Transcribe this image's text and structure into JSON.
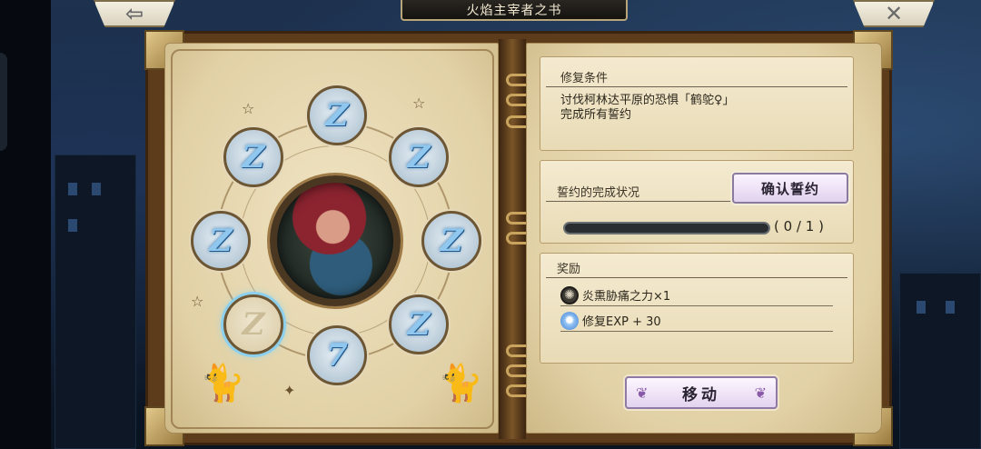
{
  "header": {
    "title": "火焰主宰者之书",
    "back_icon": "left-arrow-icon",
    "close_icon": "close-icon"
  },
  "book": {
    "slots": [
      {
        "id": "top",
        "glyph": "Z",
        "filled": true
      },
      {
        "id": "upper-right",
        "glyph": "Z",
        "filled": true
      },
      {
        "id": "right",
        "glyph": "Z",
        "filled": true
      },
      {
        "id": "lower-right",
        "glyph": "Z",
        "filled": true
      },
      {
        "id": "bottom",
        "glyph": "7",
        "filled": true
      },
      {
        "id": "lower-left",
        "glyph": "Z",
        "filled": false
      },
      {
        "id": "left",
        "glyph": "Z",
        "filled": true
      },
      {
        "id": "upper-left",
        "glyph": "Z",
        "filled": true
      }
    ]
  },
  "repair": {
    "heading": "修复条件",
    "line1": "讨伐柯林达平原的恐惧「鹤鸵♀」",
    "line2": "完成所有誓约"
  },
  "oath": {
    "heading": "誓约的完成状况",
    "confirm_label": "确认誓约",
    "progress": {
      "current": 0,
      "total": 1,
      "text": "( 0 / 1 )"
    }
  },
  "rewards": {
    "heading": "奖励",
    "items": [
      {
        "icon": "wheel-icon",
        "label": "炎熏胁痛之力×1"
      },
      {
        "icon": "blue-flame-icon",
        "label": "修复EXP + 30"
      }
    ]
  },
  "actions": {
    "move_label": "移动"
  },
  "colors": {
    "accent_purple": "#e1d2ee",
    "parchment": "#efe3c2",
    "rune_blue": "#8fc7ef",
    "progress_track": "#2b2e31"
  }
}
